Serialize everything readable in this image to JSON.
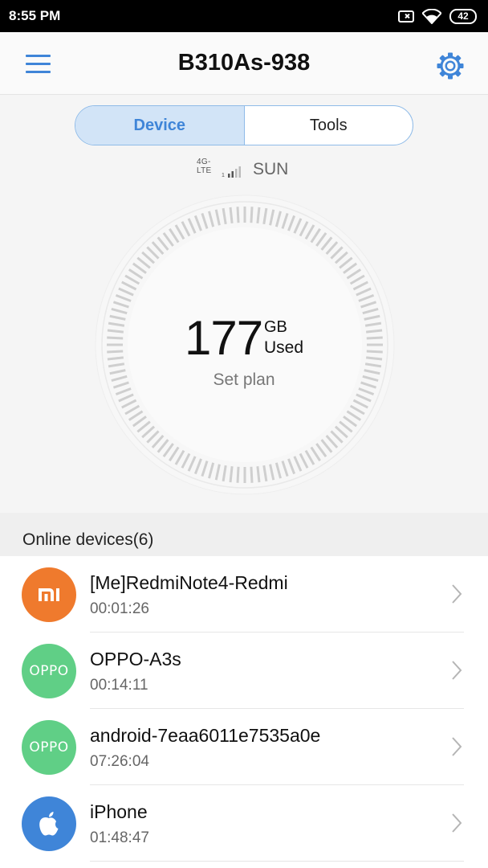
{
  "status_bar": {
    "time": "8:55 PM",
    "battery": "42",
    "icons": [
      "sim-error-icon",
      "wifi-icon",
      "battery-icon"
    ]
  },
  "header": {
    "title": "B310As-938",
    "menu_icon": "menu-icon",
    "settings_icon": "gear-icon",
    "accent_color": "#3f85d8"
  },
  "tabs": [
    {
      "label": "Device",
      "selected": true
    },
    {
      "label": "Tools",
      "selected": false
    }
  ],
  "signal": {
    "network_type": "4G-LTE",
    "carrier": "SUN"
  },
  "usage": {
    "value": "177",
    "unit": "GB",
    "label": "Used",
    "set_plan": "Set plan"
  },
  "online_devices": {
    "title": "Online devices(6)",
    "items": [
      {
        "name": "[Me]RedmiNote4-Redmi",
        "time": "00:01:26",
        "icon": "mi-logo-icon",
        "avatar_text": "",
        "color": "#ef7a2d"
      },
      {
        "name": "OPPO-A3s",
        "time": "00:14:11",
        "icon": "oppo-logo-icon",
        "avatar_text": "OPPO",
        "color": "#60cf86"
      },
      {
        "name": "android-7eaa6011e7535a0e",
        "time": "07:26:04",
        "icon": "oppo-logo-icon",
        "avatar_text": "OPPO",
        "color": "#60cf86"
      },
      {
        "name": "iPhone",
        "time": "01:48:47",
        "icon": "apple-logo-icon",
        "avatar_text": "",
        "color": "#3f85d8"
      }
    ]
  }
}
